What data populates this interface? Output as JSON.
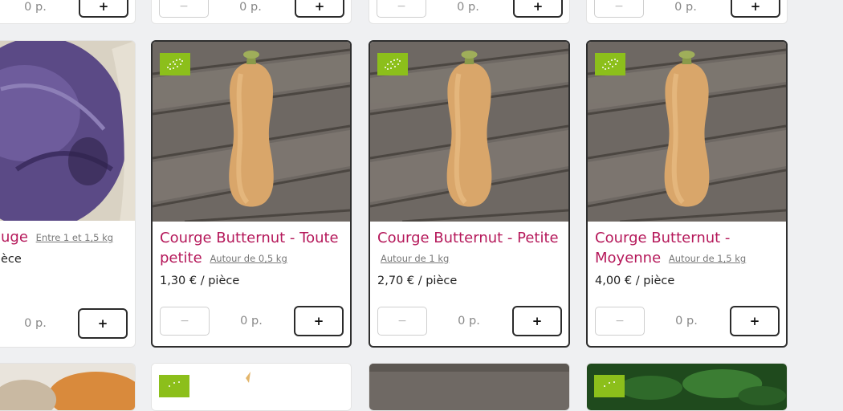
{
  "colors": {
    "accent": "#b5185a",
    "bio_badge": "#8cbf1b",
    "page_bg": "#eff0f2"
  },
  "top_row": [
    {
      "count": "0 p.",
      "plus": "+"
    },
    {
      "minus": "−",
      "count": "0 p.",
      "plus": "+"
    },
    {
      "minus": "−",
      "count": "0 p.",
      "plus": "+"
    },
    {
      "minus": "−",
      "count": "0 p.",
      "plus": "+"
    }
  ],
  "products": [
    {
      "name": "uge",
      "quantity_note": "Entre 1 et 1,5 kg",
      "price": "èce",
      "count": "0 p.",
      "plus": "+",
      "image_icon": "red-cabbage-photo"
    },
    {
      "name": "Courge Butternut - Toute petite",
      "quantity_note": "Autour de 0,5 kg",
      "price": "1,30 € / pièce",
      "minus": "−",
      "count": "0 p.",
      "plus": "+",
      "image_icon": "butternut-squash-photo",
      "bio": true
    },
    {
      "name": "Courge Butternut - Petite",
      "quantity_note": "Autour de 1 kg",
      "price": "2,70 € / pièce",
      "minus": "−",
      "count": "0 p.",
      "plus": "+",
      "image_icon": "butternut-squash-photo",
      "bio": true
    },
    {
      "name": "Courge Butternut - Moyenne",
      "quantity_note": "Autour de 1,5 kg",
      "price": "4,00 € / pièce",
      "minus": "−",
      "count": "0 p.",
      "plus": "+",
      "image_icon": "butternut-squash-photo",
      "bio": true
    }
  ],
  "bottom_row_icons": [
    "squash-photo",
    "squash-photo",
    "grey-photo",
    "spinach-photo"
  ]
}
